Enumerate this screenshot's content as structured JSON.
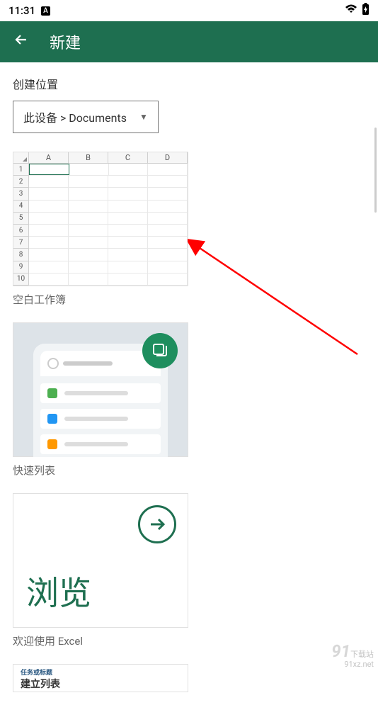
{
  "status": {
    "time": "11:31",
    "indicator": "A"
  },
  "header": {
    "title": "新建"
  },
  "location": {
    "label": "创建位置",
    "value": "此设备 > Documents"
  },
  "templates": {
    "blank": {
      "label": "空白工作簿",
      "columns": [
        "A",
        "B",
        "C",
        "D"
      ],
      "rows": [
        "1",
        "2",
        "3",
        "4",
        "5",
        "6",
        "7",
        "8",
        "9",
        "10"
      ]
    },
    "quick_list": {
      "label": "快速列表",
      "item_colors": [
        "#4caf50",
        "#2196f3",
        "#ff9800"
      ]
    },
    "welcome": {
      "label": "欢迎使用 Excel",
      "text": "浏览"
    },
    "partial": {
      "subtitle": "任务或标题",
      "title": "建立列表"
    }
  },
  "watermark": {
    "number": "91",
    "text": "下载站",
    "url": "91xz.net"
  }
}
